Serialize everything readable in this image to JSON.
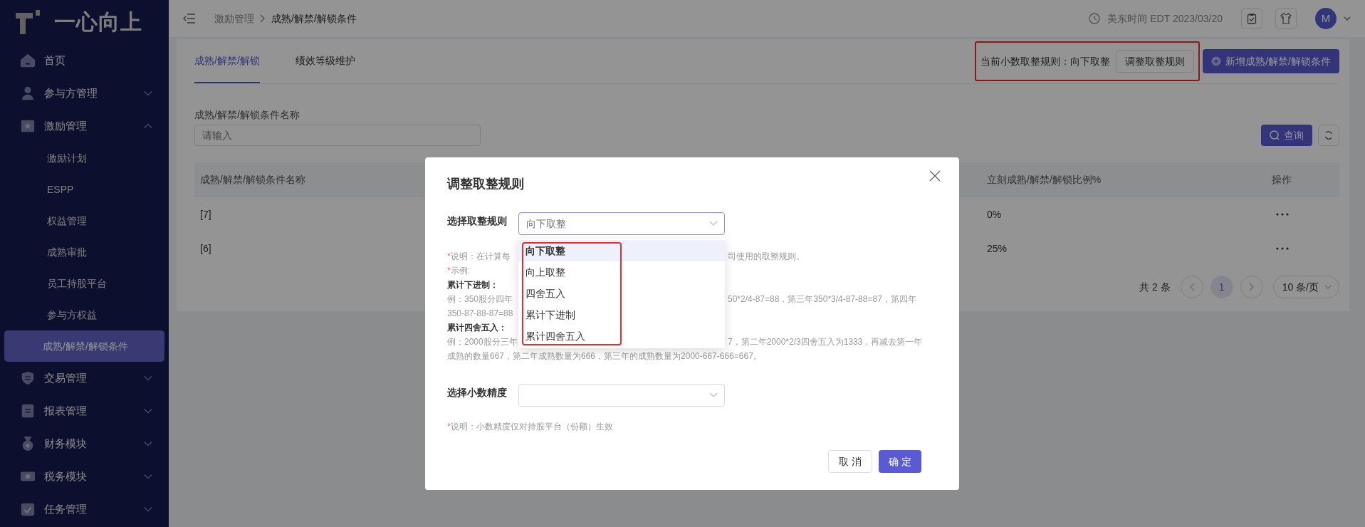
{
  "sidebar": {
    "logo": "一心向上",
    "items": [
      {
        "label": "首页",
        "kind": "link",
        "selected": false
      },
      {
        "label": "参与方管理",
        "kind": "group",
        "expanded": false,
        "selected": false
      },
      {
        "label": "激励管理",
        "kind": "group",
        "expanded": true,
        "selected": false,
        "children": [
          {
            "label": "激励计划",
            "selected": false
          },
          {
            "label": "ESPP",
            "selected": false
          },
          {
            "label": "权益管理",
            "selected": false
          },
          {
            "label": "成熟审批",
            "selected": false
          },
          {
            "label": "员工持股平台",
            "selected": false
          },
          {
            "label": "参与方权益",
            "selected": false
          },
          {
            "label": "成熟/解禁/解锁条件",
            "selected": true
          }
        ]
      },
      {
        "label": "交易管理",
        "kind": "group",
        "expanded": false,
        "selected": false
      },
      {
        "label": "报表管理",
        "kind": "group",
        "expanded": false,
        "selected": false
      },
      {
        "label": "财务模块",
        "kind": "group",
        "expanded": false,
        "selected": false
      },
      {
        "label": "税务模块",
        "kind": "group",
        "expanded": false,
        "selected": false
      },
      {
        "label": "任务管理",
        "kind": "group",
        "expanded": false,
        "selected": false
      }
    ]
  },
  "header": {
    "breadcrumb": [
      "激励管理",
      "成熟/解禁/解锁条件"
    ],
    "time": "美东时间 EDT 2023/03/20",
    "avatar": "M"
  },
  "tabs": [
    {
      "label": "成熟/解禁/解锁",
      "selected": true
    },
    {
      "label": "绩效等级维护",
      "selected": false
    }
  ],
  "rounding_rule": {
    "text": "当前小数取整规则：向下取整",
    "button": "调整取整规则"
  },
  "add_button": "新增成熟/解禁/解锁条件",
  "filter": {
    "label": "成熟/解禁/解锁条件名称",
    "placeholder": "请输入",
    "search_button": "查询"
  },
  "table": {
    "columns": [
      "成熟/解禁/解锁条件名称",
      "立刻成熟/解禁/解锁比例%",
      "操作"
    ],
    "rows": [
      {
        "name": "[7]",
        "ratio": "0%"
      },
      {
        "name": "[6]",
        "ratio": "25%"
      }
    ]
  },
  "pagination": {
    "total": "共 2 条",
    "pages": [
      {
        "label": "1",
        "selected": true
      }
    ],
    "page_size": "10 条/页"
  },
  "modal": {
    "title": "调整取整规则",
    "rounding": {
      "label": "选择取整规则",
      "placeholder": "向下取整",
      "options": [
        {
          "label": "向下取整",
          "selected": true
        },
        {
          "label": "向上取整",
          "selected": false
        },
        {
          "label": "四舍五入",
          "selected": false
        },
        {
          "label": "累计下进制",
          "selected": false
        },
        {
          "label": "累计四舍五入",
          "selected": false
        }
      ]
    },
    "notes": [
      {
        "kind": "note",
        "mark": "*",
        "parts": [
          "说明：在计算每",
          "司使用的取整规则。"
        ]
      },
      {
        "kind": "note",
        "mark": "*",
        "parts": [
          "示例:"
        ]
      },
      {
        "kind": "heading",
        "parts": [
          "累计下进制："
        ]
      },
      {
        "kind": "text",
        "parts": [
          "例：350股分四年",
          "50*2/4-87=88，第三年350*3/4-87-88=87，第四年"
        ]
      },
      {
        "kind": "text",
        "parts": [
          "350-87-88-87=88"
        ]
      },
      {
        "kind": "heading",
        "parts": [
          "累计四舍五入："
        ]
      },
      {
        "kind": "text",
        "parts": [
          "例：2000股分三年",
          "7，第二年2000*2/3四舍五入为1333，再减去第一年"
        ]
      },
      {
        "kind": "text",
        "parts": [
          "成熟的数量667，第二年成熟数量为666，第三年的成熟数量为2000-667-666=667。"
        ]
      }
    ],
    "precision": {
      "label": "选择小数精度"
    },
    "precision_note": {
      "mark": "*",
      "text": "说明：小数精度仅对持股平台（份额）生效"
    },
    "buttons": [
      {
        "label": "取 消",
        "kind": "secondary"
      },
      {
        "label": "确 定",
        "kind": "primary"
      }
    ]
  }
}
